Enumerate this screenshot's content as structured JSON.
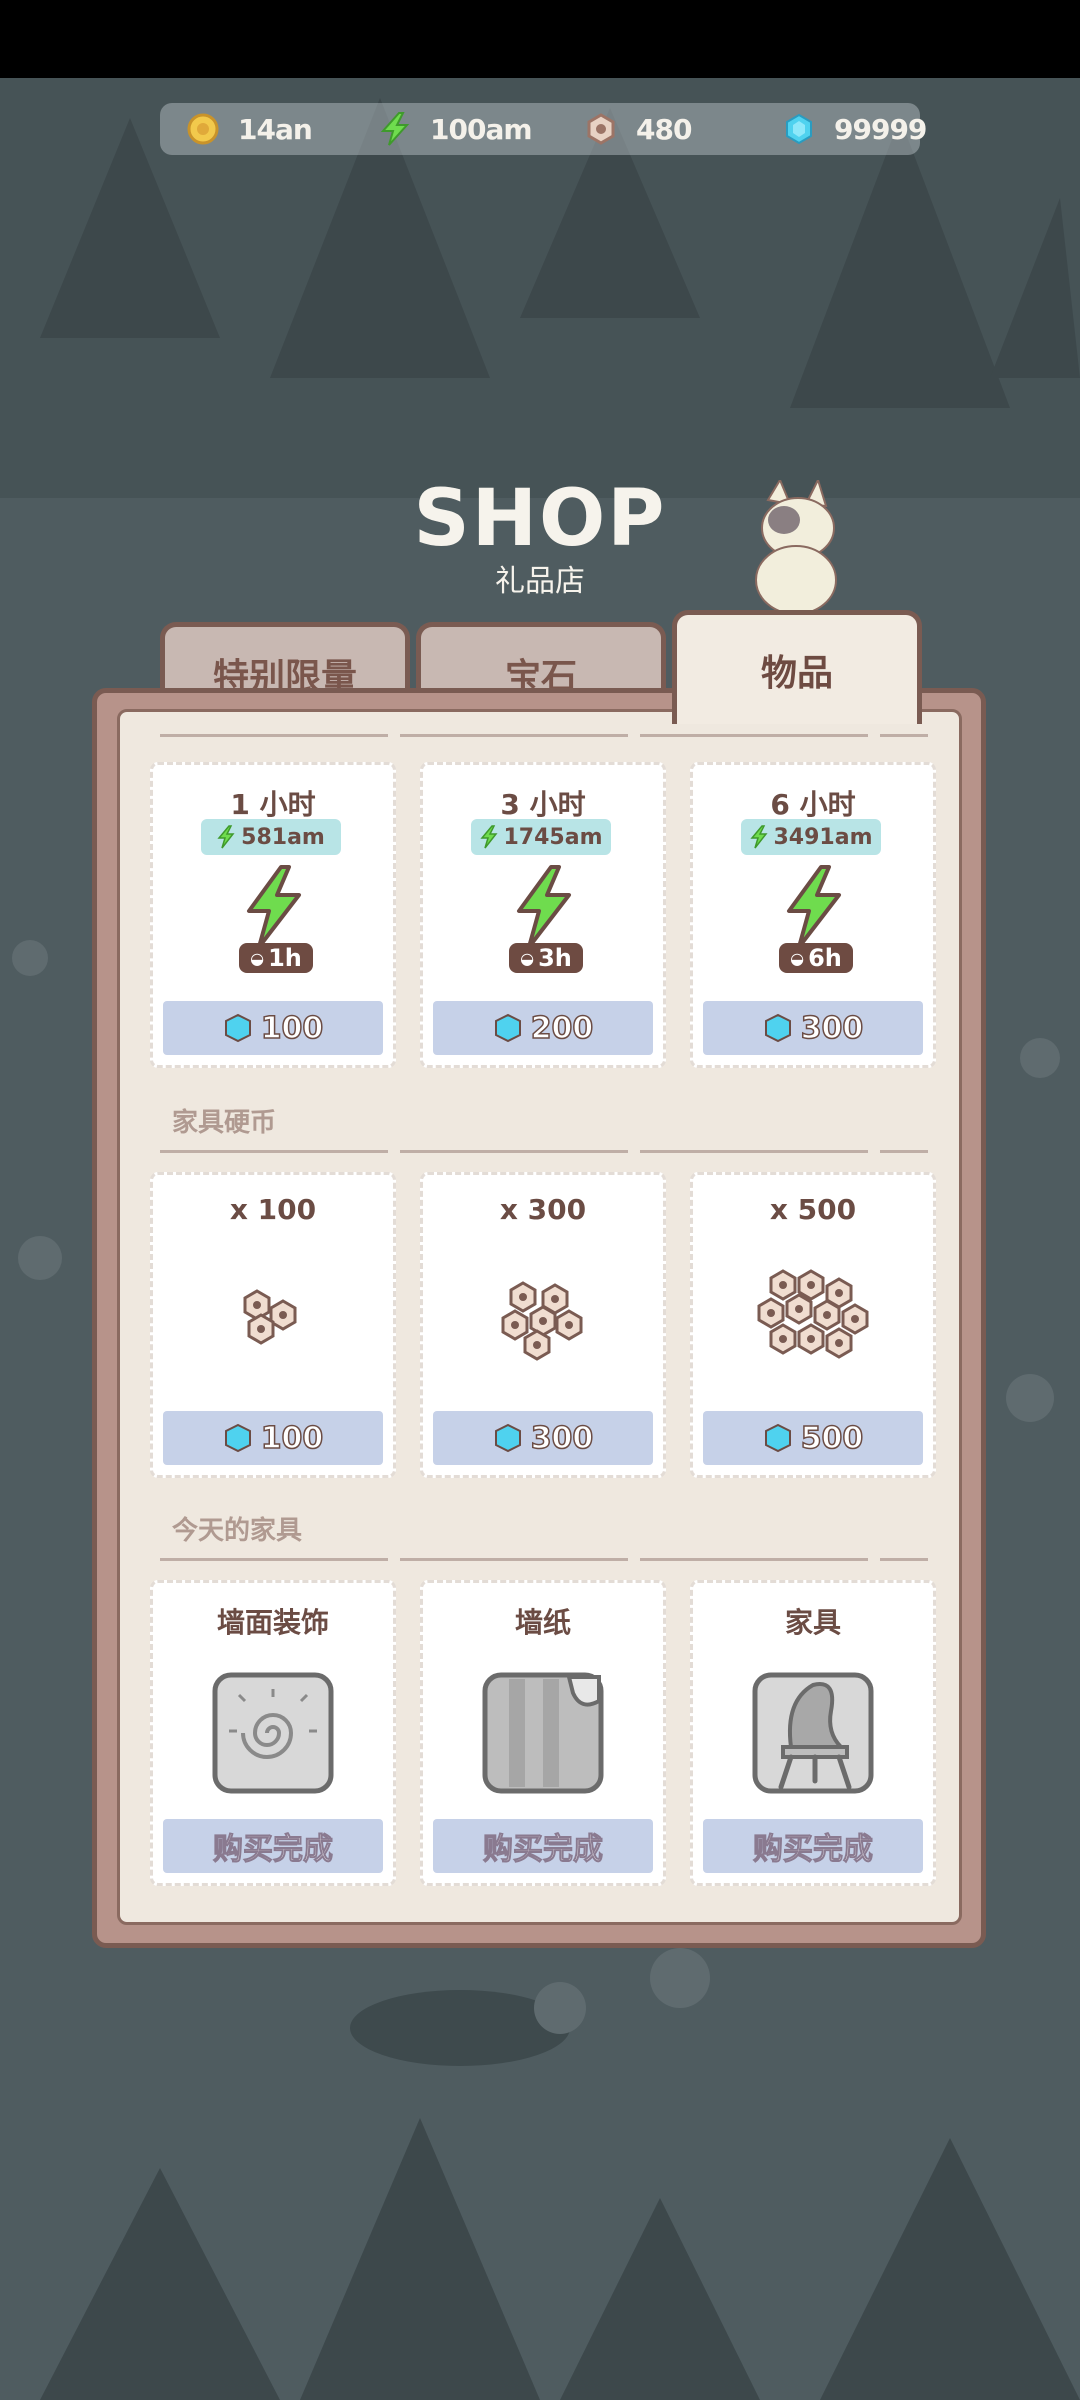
{
  "currencies": [
    {
      "icon": "gold-coin-icon",
      "value": "14an"
    },
    {
      "icon": "lightning-icon",
      "value": "100am"
    },
    {
      "icon": "nut-coin-icon",
      "value": "480"
    },
    {
      "icon": "blue-gem-icon",
      "value": "99999"
    }
  ],
  "header": {
    "title": "SHOP",
    "subtitle": "礼品店"
  },
  "tabs": [
    {
      "label": "特别限量",
      "active": false
    },
    {
      "label": "宝石",
      "active": false
    },
    {
      "label": "物品",
      "active": true
    }
  ],
  "energy_items": [
    {
      "title": "1 小时",
      "energy": "581am",
      "duration": "1h",
      "price": "100"
    },
    {
      "title": "3 小时",
      "energy": "1745am",
      "duration": "3h",
      "price": "200"
    },
    {
      "title": "6 小时",
      "energy": "3491am",
      "duration": "6h",
      "price": "300"
    }
  ],
  "furniture_coins": {
    "label": "家具硬币",
    "items": [
      {
        "title": "x 100",
        "price": "100"
      },
      {
        "title": "x 300",
        "price": "300"
      },
      {
        "title": "x 500",
        "price": "500"
      }
    ]
  },
  "todays_furniture": {
    "label": "今天的家具",
    "items": [
      {
        "title": "墙面装饰",
        "status": "购买完成",
        "icon": "wall-decoration-icon"
      },
      {
        "title": "墙纸",
        "status": "购买完成",
        "icon": "wallpaper-icon"
      },
      {
        "title": "家具",
        "status": "购买完成",
        "icon": "chair-icon"
      }
    ]
  }
}
